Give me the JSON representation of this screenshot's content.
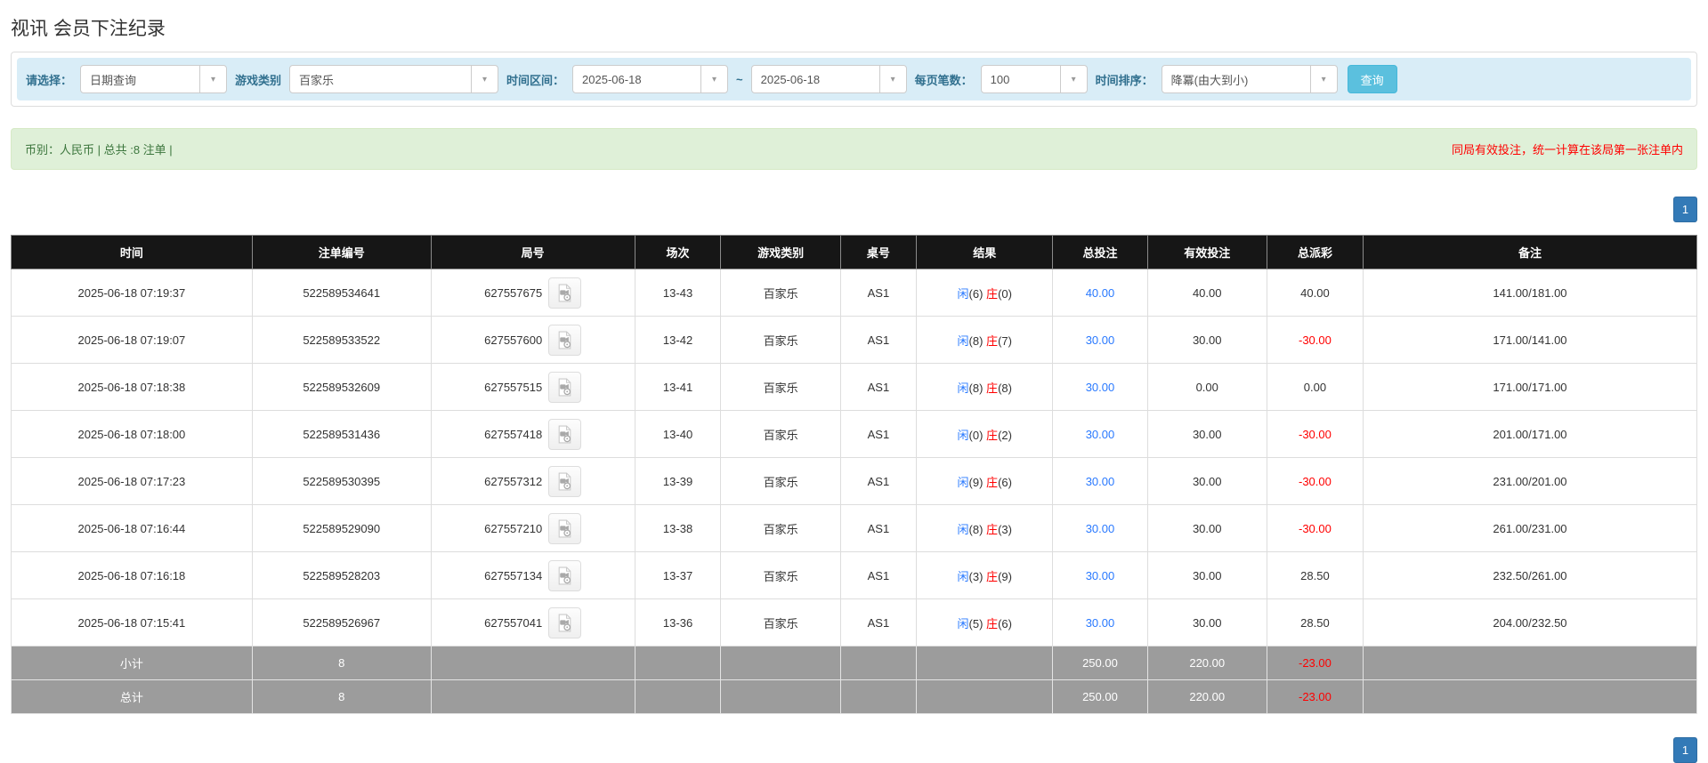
{
  "page": {
    "title": "视讯 会员下注纪录"
  },
  "colors": {
    "accent_blue": "#2979ff",
    "result_red": "#ff0000",
    "header_bg": "#161616",
    "filter_bar_bg": "#d9edf7",
    "summary_bg": "#dff0d8",
    "search_button_bg": "#5bc0de",
    "pagination_bg": "#337ab7",
    "footer_bg": "#9c9c9c"
  },
  "filters": {
    "select_label": "请选择：",
    "select_value": "日期查询",
    "game_type_label": "游戏类别",
    "game_type_value": "百家乐",
    "date_range_label": "时间区间：",
    "date_from": "2025-06-18",
    "date_separator": "~",
    "date_to": "2025-06-18",
    "page_size_label": "每页笔数：",
    "page_size_value": "100",
    "sort_label": "时间排序：",
    "sort_value": "降冪(由大到小)",
    "search_button": "查询"
  },
  "summary": {
    "left_text": "币别：人民币 | 总共 :8 注单 |",
    "right_notice": "同局有效投注，统一计算在该局第一张注单内"
  },
  "pagination": {
    "page": "1"
  },
  "table": {
    "headers": [
      "时间",
      "注单编号",
      "局号",
      "场次",
      "游戏类别",
      "桌号",
      "结果",
      "总投注",
      "有效投注",
      "总派彩",
      "备注"
    ],
    "rows": [
      {
        "time": "2025-06-18 07:19:37",
        "bet_id": "522589534641",
        "round_id": "627557675",
        "session": "13-43",
        "game": "百家乐",
        "table_no": "AS1",
        "result_player_label": "闲",
        "result_player_num": "(6)",
        "result_banker_label": "庄",
        "result_banker_num": "(0)",
        "total_bet": "40.00",
        "valid_bet": "40.00",
        "payout": "40.00",
        "remark": "141.00/181.00"
      },
      {
        "time": "2025-06-18 07:19:07",
        "bet_id": "522589533522",
        "round_id": "627557600",
        "session": "13-42",
        "game": "百家乐",
        "table_no": "AS1",
        "result_player_label": "闲",
        "result_player_num": "(8)",
        "result_banker_label": "庄",
        "result_banker_num": "(7)",
        "total_bet": "30.00",
        "valid_bet": "30.00",
        "payout": "-30.00",
        "remark": "171.00/141.00"
      },
      {
        "time": "2025-06-18 07:18:38",
        "bet_id": "522589532609",
        "round_id": "627557515",
        "session": "13-41",
        "game": "百家乐",
        "table_no": "AS1",
        "result_player_label": "闲",
        "result_player_num": "(8)",
        "result_banker_label": "庄",
        "result_banker_num": "(8)",
        "total_bet": "30.00",
        "valid_bet": "0.00",
        "payout": "0.00",
        "remark": "171.00/171.00"
      },
      {
        "time": "2025-06-18 07:18:00",
        "bet_id": "522589531436",
        "round_id": "627557418",
        "session": "13-40",
        "game": "百家乐",
        "table_no": "AS1",
        "result_player_label": "闲",
        "result_player_num": "(0)",
        "result_banker_label": "庄",
        "result_banker_num": "(2)",
        "total_bet": "30.00",
        "valid_bet": "30.00",
        "payout": "-30.00",
        "remark": "201.00/171.00"
      },
      {
        "time": "2025-06-18 07:17:23",
        "bet_id": "522589530395",
        "round_id": "627557312",
        "session": "13-39",
        "game": "百家乐",
        "table_no": "AS1",
        "result_player_label": "闲",
        "result_player_num": "(9)",
        "result_banker_label": "庄",
        "result_banker_num": "(6)",
        "total_bet": "30.00",
        "valid_bet": "30.00",
        "payout": "-30.00",
        "remark": "231.00/201.00"
      },
      {
        "time": "2025-06-18 07:16:44",
        "bet_id": "522589529090",
        "round_id": "627557210",
        "session": "13-38",
        "game": "百家乐",
        "table_no": "AS1",
        "result_player_label": "闲",
        "result_player_num": "(8)",
        "result_banker_label": "庄",
        "result_banker_num": "(3)",
        "total_bet": "30.00",
        "valid_bet": "30.00",
        "payout": "-30.00",
        "remark": "261.00/231.00"
      },
      {
        "time": "2025-06-18 07:16:18",
        "bet_id": "522589528203",
        "round_id": "627557134",
        "session": "13-37",
        "game": "百家乐",
        "table_no": "AS1",
        "result_player_label": "闲",
        "result_player_num": "(3)",
        "result_banker_label": "庄",
        "result_banker_num": "(9)",
        "total_bet": "30.00",
        "valid_bet": "30.00",
        "payout": "28.50",
        "remark": "232.50/261.00"
      },
      {
        "time": "2025-06-18 07:15:41",
        "bet_id": "522589526967",
        "round_id": "627557041",
        "session": "13-36",
        "game": "百家乐",
        "table_no": "AS1",
        "result_player_label": "闲",
        "result_player_num": "(5)",
        "result_banker_label": "庄",
        "result_banker_num": "(6)",
        "total_bet": "30.00",
        "valid_bet": "30.00",
        "payout": "28.50",
        "remark": "204.00/232.50"
      }
    ],
    "footer": [
      {
        "label": "小计",
        "count": "8",
        "total_bet": "250.00",
        "valid_bet": "220.00",
        "payout": "-23.00"
      },
      {
        "label": "总计",
        "count": "8",
        "total_bet": "250.00",
        "valid_bet": "220.00",
        "payout": "-23.00"
      }
    ]
  }
}
